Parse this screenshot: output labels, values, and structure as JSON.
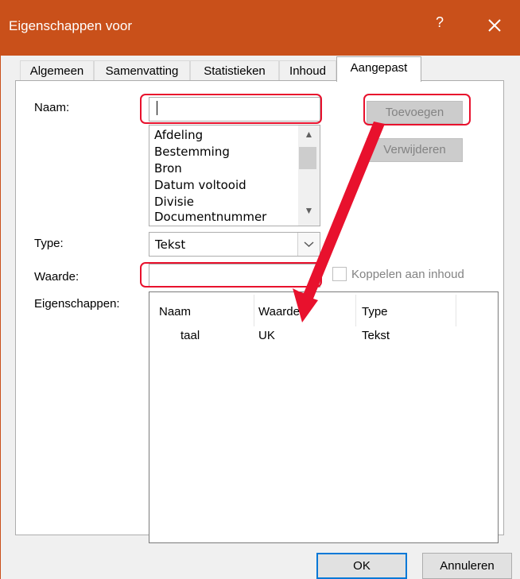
{
  "window": {
    "title": "Eigenschappen voor",
    "help_label": "?",
    "close_icon": "close-icon",
    "title_bar_color": "#c9501a"
  },
  "tabs": [
    {
      "label": "Algemeen",
      "active": false
    },
    {
      "label": "Samenvatting",
      "active": false
    },
    {
      "label": "Statistieken",
      "active": false
    },
    {
      "label": "Inhoud",
      "active": false
    },
    {
      "label": "Aangepast",
      "active": true
    }
  ],
  "form": {
    "name_label": "Naam:",
    "name_value": "",
    "type_label": "Type:",
    "type_value": "Tekst",
    "value_label": "Waarde:",
    "value_value": "",
    "link_checkbox_label": "Koppelen aan inhoud",
    "link_checked": false,
    "properties_label": "Eigenschappen:"
  },
  "name_list": [
    "Afdeling",
    "Bestemming",
    "Bron",
    "Datum voltooid",
    "Divisie",
    "Documentnummer"
  ],
  "buttons": {
    "add": "Toevoegen",
    "remove": "Verwijderen",
    "ok": "OK",
    "cancel": "Annuleren"
  },
  "properties_table": {
    "columns": [
      "Naam",
      "Waarde",
      "Type"
    ],
    "rows": [
      {
        "name": "taal",
        "value": "UK",
        "type": "Tekst"
      }
    ]
  },
  "annotation_color": "#e8112d"
}
